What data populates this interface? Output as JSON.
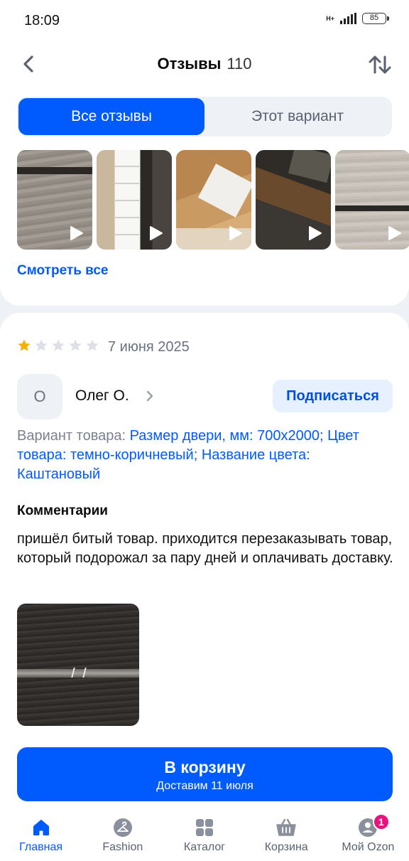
{
  "status_bar": {
    "time": "18:09",
    "network": "H+",
    "battery": "85"
  },
  "header": {
    "title": "Отзывы",
    "count": "110",
    "back_icon": "chevron-left-icon",
    "sort_icon": "sort-arrows-icon"
  },
  "tabs": [
    {
      "label": "Все отзывы",
      "active": true
    },
    {
      "label": "Этот вариант",
      "active": false
    }
  ],
  "media": {
    "items": [
      {
        "type": "video",
        "icon": "play-icon"
      },
      {
        "type": "video",
        "icon": "play-icon"
      },
      {
        "type": "video",
        "icon": "play-icon"
      },
      {
        "type": "video",
        "icon": "play-icon"
      },
      {
        "type": "video",
        "icon": "play-icon"
      }
    ],
    "view_all": "Смотреть все"
  },
  "review": {
    "rating": 1,
    "max_rating": 5,
    "date": "7 июня 2025",
    "author_initial": "О",
    "author_name": "Олег О.",
    "subscribe_label": "Подписаться",
    "variant_prefix": "Вариант товара: ",
    "variant_value": "Размер двери, мм: 700x2000; Цвет товара: темно-коричневый; Название цвета: Каштановый",
    "comments_title": "Комментарии",
    "comment": "пришёл битый товар. приходится перезаказывать товар, который подорожал за пару дней и оплачивать доставку."
  },
  "cart_button": {
    "label": "В корзину",
    "sublabel": "Доставим 11 июля"
  },
  "nav": {
    "items": [
      {
        "label": "Главная",
        "icon": "home-icon",
        "active": true
      },
      {
        "label": "Fashion",
        "icon": "hanger-icon",
        "active": false
      },
      {
        "label": "Каталог",
        "icon": "catalog-grid-icon",
        "active": false
      },
      {
        "label": "Корзина",
        "icon": "basket-icon",
        "active": false
      },
      {
        "label": "Мой Ozon",
        "icon": "profile-icon",
        "active": false,
        "badge": "1"
      }
    ]
  },
  "colors": {
    "accent": "#005bff",
    "badge": "#e8137e",
    "star_filled": "#f9b000",
    "star_empty": "#dde1e7"
  }
}
